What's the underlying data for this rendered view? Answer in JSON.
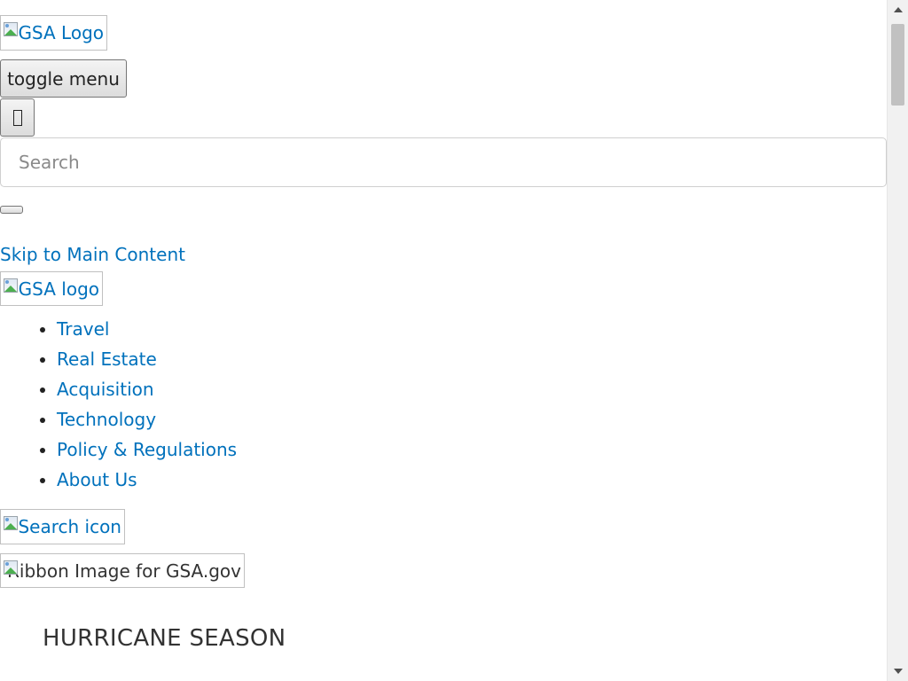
{
  "header": {
    "logo_alt": "GSA Logo",
    "toggle_menu_label": "toggle menu",
    "search": {
      "placeholder": "Search",
      "value": ""
    }
  },
  "skip_link": "Skip to Main Content",
  "nav": {
    "logo_alt": "GSA logo",
    "items": [
      {
        "label": "Travel"
      },
      {
        "label": "Real Estate"
      },
      {
        "label": "Acquisition"
      },
      {
        "label": "Technology"
      },
      {
        "label": "Policy & Regulations"
      },
      {
        "label": "About Us"
      }
    ],
    "search_icon_alt": "Search icon"
  },
  "ribbon": {
    "image_alt": "Ribbon Image for GSA.gov"
  },
  "main": {
    "heading": "HURRICANE SEASON"
  },
  "colors": {
    "link": "#0071bc",
    "text": "#333333",
    "background": "#ffffff"
  }
}
